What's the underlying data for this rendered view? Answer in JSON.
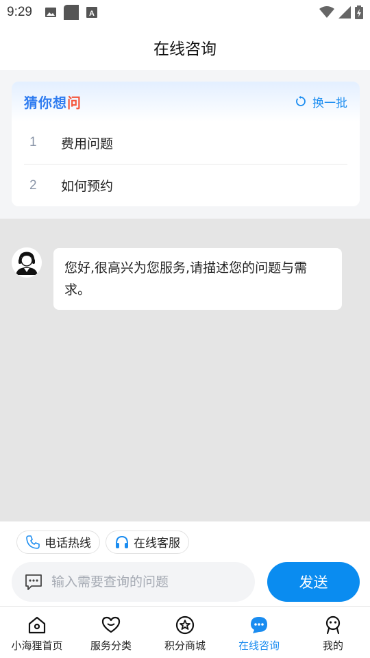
{
  "status_bar": {
    "time": "9:29"
  },
  "header": {
    "title": "在线咨询"
  },
  "guess": {
    "title_main": "猜你想",
    "title_accent": "问",
    "refresh_label": "换一批",
    "items": [
      {
        "num": "1",
        "text": "费用问题"
      },
      {
        "num": "2",
        "text": "如何预约"
      }
    ]
  },
  "chat": {
    "messages": [
      {
        "sender": "agent",
        "text": "您好,很高兴为您服务,请描述您的问题与需求。"
      }
    ]
  },
  "quick_actions": [
    {
      "label": "电话热线",
      "icon": "phone-icon"
    },
    {
      "label": "在线客服",
      "icon": "headset-icon"
    }
  ],
  "composer": {
    "placeholder": "输入需要查询的问题",
    "value": "",
    "send_label": "发送"
  },
  "tab_bar": {
    "tabs": [
      {
        "label": "小海狸首页",
        "icon": "home-icon",
        "active": false
      },
      {
        "label": "服务分类",
        "icon": "heart-icon",
        "active": false
      },
      {
        "label": "积分商城",
        "icon": "star-icon",
        "active": false
      },
      {
        "label": "在线咨询",
        "icon": "chat-bubble-icon",
        "active": true
      },
      {
        "label": "我的",
        "icon": "profile-icon",
        "active": false
      }
    ]
  },
  "colors": {
    "accent": "#1a8cf0",
    "send_button": "#0a8cf0",
    "title_accent": "#f5563c",
    "chat_background": "#e5e5e5"
  }
}
